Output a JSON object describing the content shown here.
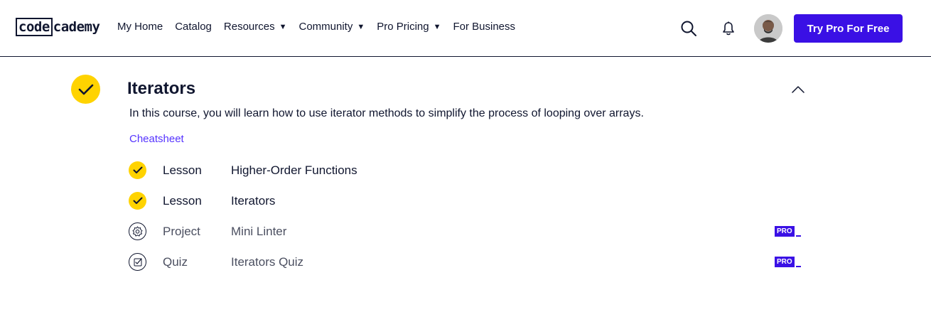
{
  "header": {
    "logo_boxed": "code",
    "logo_rest": "cademy",
    "nav": [
      {
        "label": "My Home",
        "caret": ""
      },
      {
        "label": "Catalog",
        "caret": ""
      },
      {
        "label": "Resources",
        "caret": "▼"
      },
      {
        "label": "Community",
        "caret": "▼"
      },
      {
        "label": "Pro Pricing",
        "caret": "▼"
      },
      {
        "label": "For Business",
        "caret": ""
      }
    ],
    "cta_label": "Try Pro For Free",
    "icons": [
      "search-icon",
      "bell-icon"
    ]
  },
  "module": {
    "title": "Iterators",
    "description": "In this course, you will learn how to use iterator methods to simplify the process of looping over arrays.",
    "cheatsheet_label": "Cheatsheet",
    "items": [
      {
        "type": "Lesson",
        "name": "Higher-Order Functions",
        "status": "completed",
        "pro": ""
      },
      {
        "type": "Lesson",
        "name": "Iterators",
        "status": "completed",
        "pro": ""
      },
      {
        "type": "Project",
        "name": "Mini Linter",
        "status": "locked",
        "pro": "PRO"
      },
      {
        "type": "Quiz",
        "name": "Iterators Quiz",
        "status": "locked",
        "pro": "PRO"
      }
    ]
  },
  "colors": {
    "brand_purple": "#3a10e5",
    "complete_yellow": "#ffd300",
    "navy": "#10162f",
    "link": "#5533ff"
  }
}
